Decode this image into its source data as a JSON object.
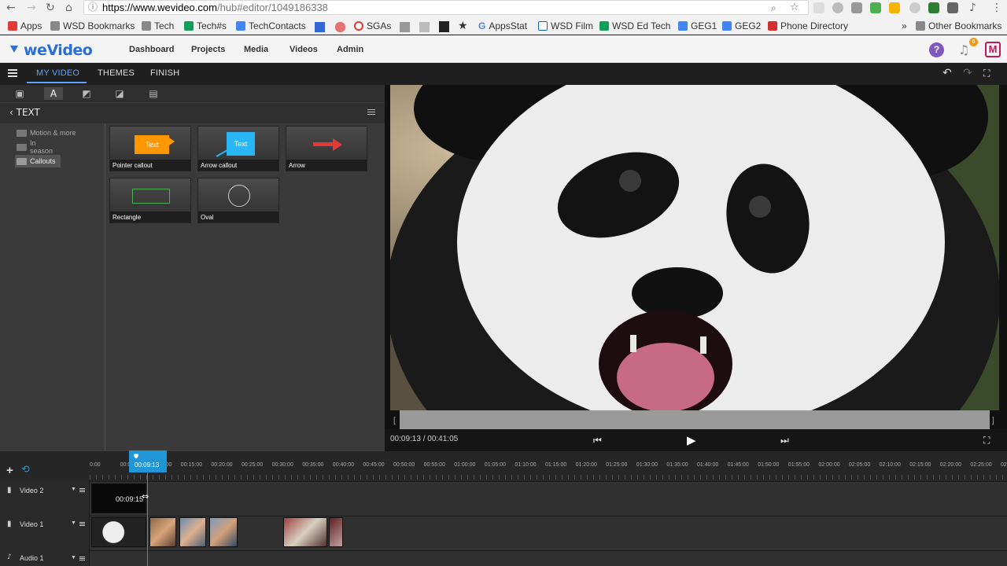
{
  "browser": {
    "url_domain": "https://www.wevideo.com",
    "url_path": "/hub#editor/1049186338",
    "bookmarks": [
      "Apps",
      "WSD Bookmarks",
      "Tech",
      "Tech#s",
      "TechContacts",
      "SGAs",
      "AppsStat",
      "WSD Film",
      "WSD Ed Tech",
      "GEG1",
      "GEG2",
      "Phone Directory"
    ],
    "other_bookmarks": "Other Bookmarks",
    "more": "»"
  },
  "app": {
    "logo": "weVideo",
    "menu": [
      "Dashboard",
      "Projects",
      "Media",
      "Videos",
      "Admin"
    ],
    "notifications_count": "6",
    "avatar": "M"
  },
  "editor": {
    "tabs": [
      "MY VIDEO",
      "THEMES",
      "FINISH"
    ],
    "section_title": "TEXT",
    "categories": [
      "Motion & more",
      "In season",
      "Callouts"
    ],
    "cards": [
      "Pointer callout",
      "Arrow callout",
      "Arrow",
      "Rectangle",
      "Oval"
    ],
    "card_text": "Text"
  },
  "preview": {
    "timecode": "00:09:13 / 00:41:05"
  },
  "timeline": {
    "playhead": "00:09:13",
    "ruler": [
      "0:00",
      "00:05:00",
      "00:10:00",
      "00:15:00",
      "00:20:00",
      "00:25:00",
      "00:30:00",
      "00:35:00",
      "00:40:00",
      "00:45:00",
      "00:50:00",
      "00:55:00",
      "01:00:00",
      "01:05:00",
      "01:10:00",
      "01:15:00",
      "01:20:00",
      "01:25:00",
      "01:30:00",
      "01:35:00",
      "01:40:00",
      "01:45:00",
      "01:50:00",
      "01:55:00",
      "02:00:00",
      "02:05:00",
      "02:10:00",
      "02:15:00",
      "02:20:00",
      "02:25:00",
      "02:3"
    ],
    "tracks": [
      "Video 2",
      "Video 1",
      "Audio 1"
    ],
    "clip_time": "00:09:15"
  },
  "colors": {
    "accent": "#2196d6",
    "brand": "#2a6fd6",
    "active_tab": "#5ea3ff"
  }
}
